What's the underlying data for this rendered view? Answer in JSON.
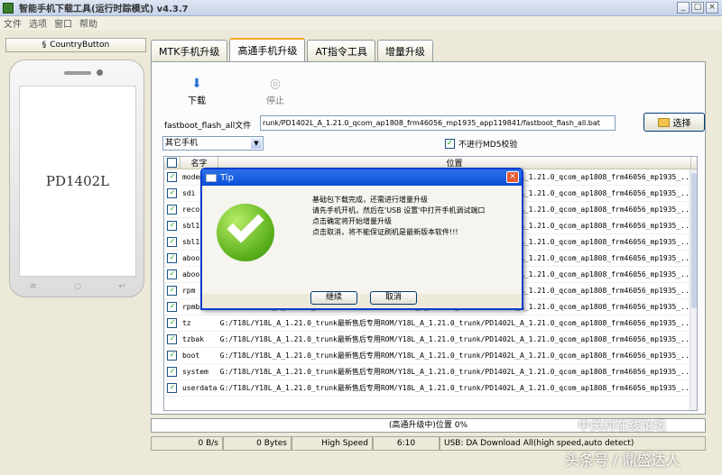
{
  "window": {
    "title": "智能手机下载工具(运行时踪模式)   v4.3.7",
    "min": "_",
    "max": "□",
    "close": "×"
  },
  "menu": [
    "文件",
    "选项",
    "窗口",
    "帮助"
  ],
  "sidebar": {
    "country_button": "CountryButton",
    "phone_model": "PD1402L"
  },
  "tabs": [
    "MTK手机升级",
    "高通手机升级",
    "AT指令工具",
    "增量升级"
  ],
  "toolbar": {
    "download": "下载",
    "stop": "停止"
  },
  "fastboot": {
    "label": "fastboot_flash_all文件",
    "path": "runk/PD1402L_A_1.21.0_qcom_ap1808_frm46056_mp1935_app119841/fastboot_flash_all.bat",
    "choose": "选择"
  },
  "phone_select": "其它手机",
  "md5_label": "不进行MD5校验",
  "table": {
    "headers": {
      "name": "名字",
      "location": "位置"
    },
    "rows": [
      {
        "name": "modem",
        "path": "G:/T18L/Y18L_A_1.21.0_trunk最新售后专用ROM/Y18L_A_1.21.0_trunk/PD1402L_A_1.21.0_qcom_ap1808_frm46056_mp1935_..."
      },
      {
        "name": "sdi",
        "path": "G:/T18L/Y18L_A_1.21.0_trunk最新售后专用ROM/Y18L_A_1.21.0_trunk/PD1402L_A_1.21.0_qcom_ap1808_frm46056_mp1935_..."
      },
      {
        "name": "recovery",
        "path": "G:/T18L/Y18L_A_1.21.0_trunk最新售后专用ROM/Y18L_A_1.21.0_trunk/PD1402L_A_1.21.0_qcom_ap1808_frm46056_mp1935_..."
      },
      {
        "name": "sbl1",
        "path": "G:/T18L/Y18L_A_1.21.0_trunk最新售后专用ROM/Y18L_A_1.21.0_trunk/PD1402L_A_1.21.0_qcom_ap1808_frm46056_mp1935_..."
      },
      {
        "name": "sbl1bak",
        "path": "G:/T18L/Y18L_A_1.21.0_trunk最新售后专用ROM/Y18L_A_1.21.0_trunk/PD1402L_A_1.21.0_qcom_ap1808_frm46056_mp1935_..."
      },
      {
        "name": "aboot",
        "path": "G:/T18L/Y18L_A_1.21.0_trunk最新售后专用ROM/Y18L_A_1.21.0_trunk/PD1402L_A_1.21.0_qcom_ap1808_frm46056_mp1935_..."
      },
      {
        "name": "abootbak",
        "path": "G:/T18L/Y18L_A_1.21.0_trunk最新售后专用ROM/Y18L_A_1.21.0_trunk/PD1402L_A_1.21.0_qcom_ap1808_frm46056_mp1935_..."
      },
      {
        "name": "rpm",
        "path": "G:/T18L/Y18L_A_1.21.0_trunk最新售后专用ROM/Y18L_A_1.21.0_trunk/PD1402L_A_1.21.0_qcom_ap1808_frm46056_mp1935_..."
      },
      {
        "name": "rpmbak",
        "path": "G:/T18L/Y18L_A_1.21.0_trunk最新售后专用ROM/Y18L_A_1.21.0_trunk/PD1402L_A_1.21.0_qcom_ap1808_frm46056_mp1935_..."
      },
      {
        "name": "tz",
        "path": "G:/T18L/Y18L_A_1.21.0_trunk最新售后专用ROM/Y18L_A_1.21.0_trunk/PD1402L_A_1.21.0_qcom_ap1808_frm46056_mp1935_..."
      },
      {
        "name": "tzbak",
        "path": "G:/T18L/Y18L_A_1.21.0_trunk最新售后专用ROM/Y18L_A_1.21.0_trunk/PD1402L_A_1.21.0_qcom_ap1808_frm46056_mp1935_..."
      },
      {
        "name": "boot",
        "path": "G:/T18L/Y18L_A_1.21.0_trunk最新售后专用ROM/Y18L_A_1.21.0_trunk/PD1402L_A_1.21.0_qcom_ap1808_frm46056_mp1935_..."
      },
      {
        "name": "system",
        "path": "G:/T18L/Y18L_A_1.21.0_trunk最新售后专用ROM/Y18L_A_1.21.0_trunk/PD1402L_A_1.21.0_qcom_ap1808_frm46056_mp1935_..."
      },
      {
        "name": "userdata",
        "path": "G:/T18L/Y18L_A_1.21.0_trunk最新售后专用ROM/Y18L_A_1.21.0_trunk/PD1402L_A_1.21.0_qcom_ap1808_frm46056_mp1935_..."
      }
    ]
  },
  "progress_text": "(高通升级中)位置 0%",
  "status": {
    "speed": "0 B/s",
    "bytes": "0 Bytes",
    "mode": "High Speed",
    "time": "6:10",
    "usb": "USB: DA Download All(high speed,auto detect)"
  },
  "dialog": {
    "title": "Tip",
    "lines": [
      "基础包下载完成，还需进行增量升级",
      "请先手机开机，然后在'USB 设置'中打开手机调试端口",
      "点击确定将开始增量升级",
      "点击取消，将不能保证刷机是最新版本软件!!!"
    ],
    "ok": "继续",
    "cancel": "取消"
  },
  "watermark": {
    "line1": "中关村在线论坛",
    "line2": "头条号 / 鼎盛达人"
  }
}
